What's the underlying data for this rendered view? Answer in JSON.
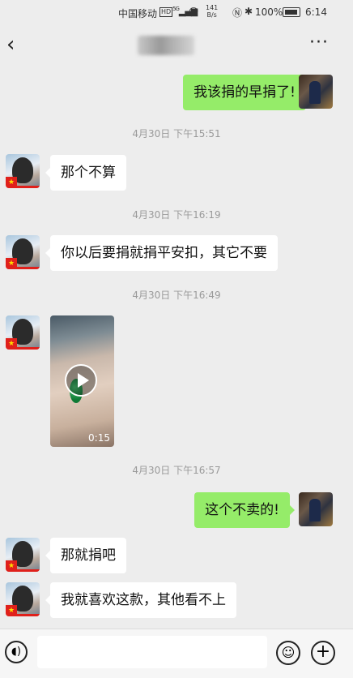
{
  "status_bar": {
    "carrier": "中国移动",
    "hd": "HD",
    "signal": "5G",
    "net_speed_value": "141",
    "net_speed_unit": "B/s",
    "battery": "100%",
    "time": "6:14"
  },
  "nav": {
    "back_icon": "chevron-left",
    "more_icon": "ellipsis"
  },
  "messages": [
    {
      "side": "right",
      "text": "我该捐的早捐了!"
    },
    {
      "timestamp": "4月30日 下午15:51"
    },
    {
      "side": "left",
      "text": "那个不算"
    },
    {
      "timestamp": "4月30日 下午16:19"
    },
    {
      "side": "left",
      "text": "你以后要捐就捐平安扣，其它不要"
    },
    {
      "timestamp": "4月30日 下午16:49"
    },
    {
      "side": "left",
      "type": "video",
      "duration": "0:15"
    },
    {
      "timestamp": "4月30日 下午16:57"
    },
    {
      "side": "right",
      "text": "这个不卖的!"
    },
    {
      "side": "left",
      "text": "那就捐吧"
    },
    {
      "side": "left",
      "text": "我就喜欢这款，其他看不上"
    }
  ],
  "input_bar": {
    "voice_icon": "voice",
    "text": "",
    "emoji_icon": "emoji",
    "plus_icon": "plus"
  },
  "colors": {
    "background": "#ededed",
    "my_bubble": "#95ec69",
    "their_bubble": "#ffffff",
    "timestamp": "#9a9a9a"
  }
}
